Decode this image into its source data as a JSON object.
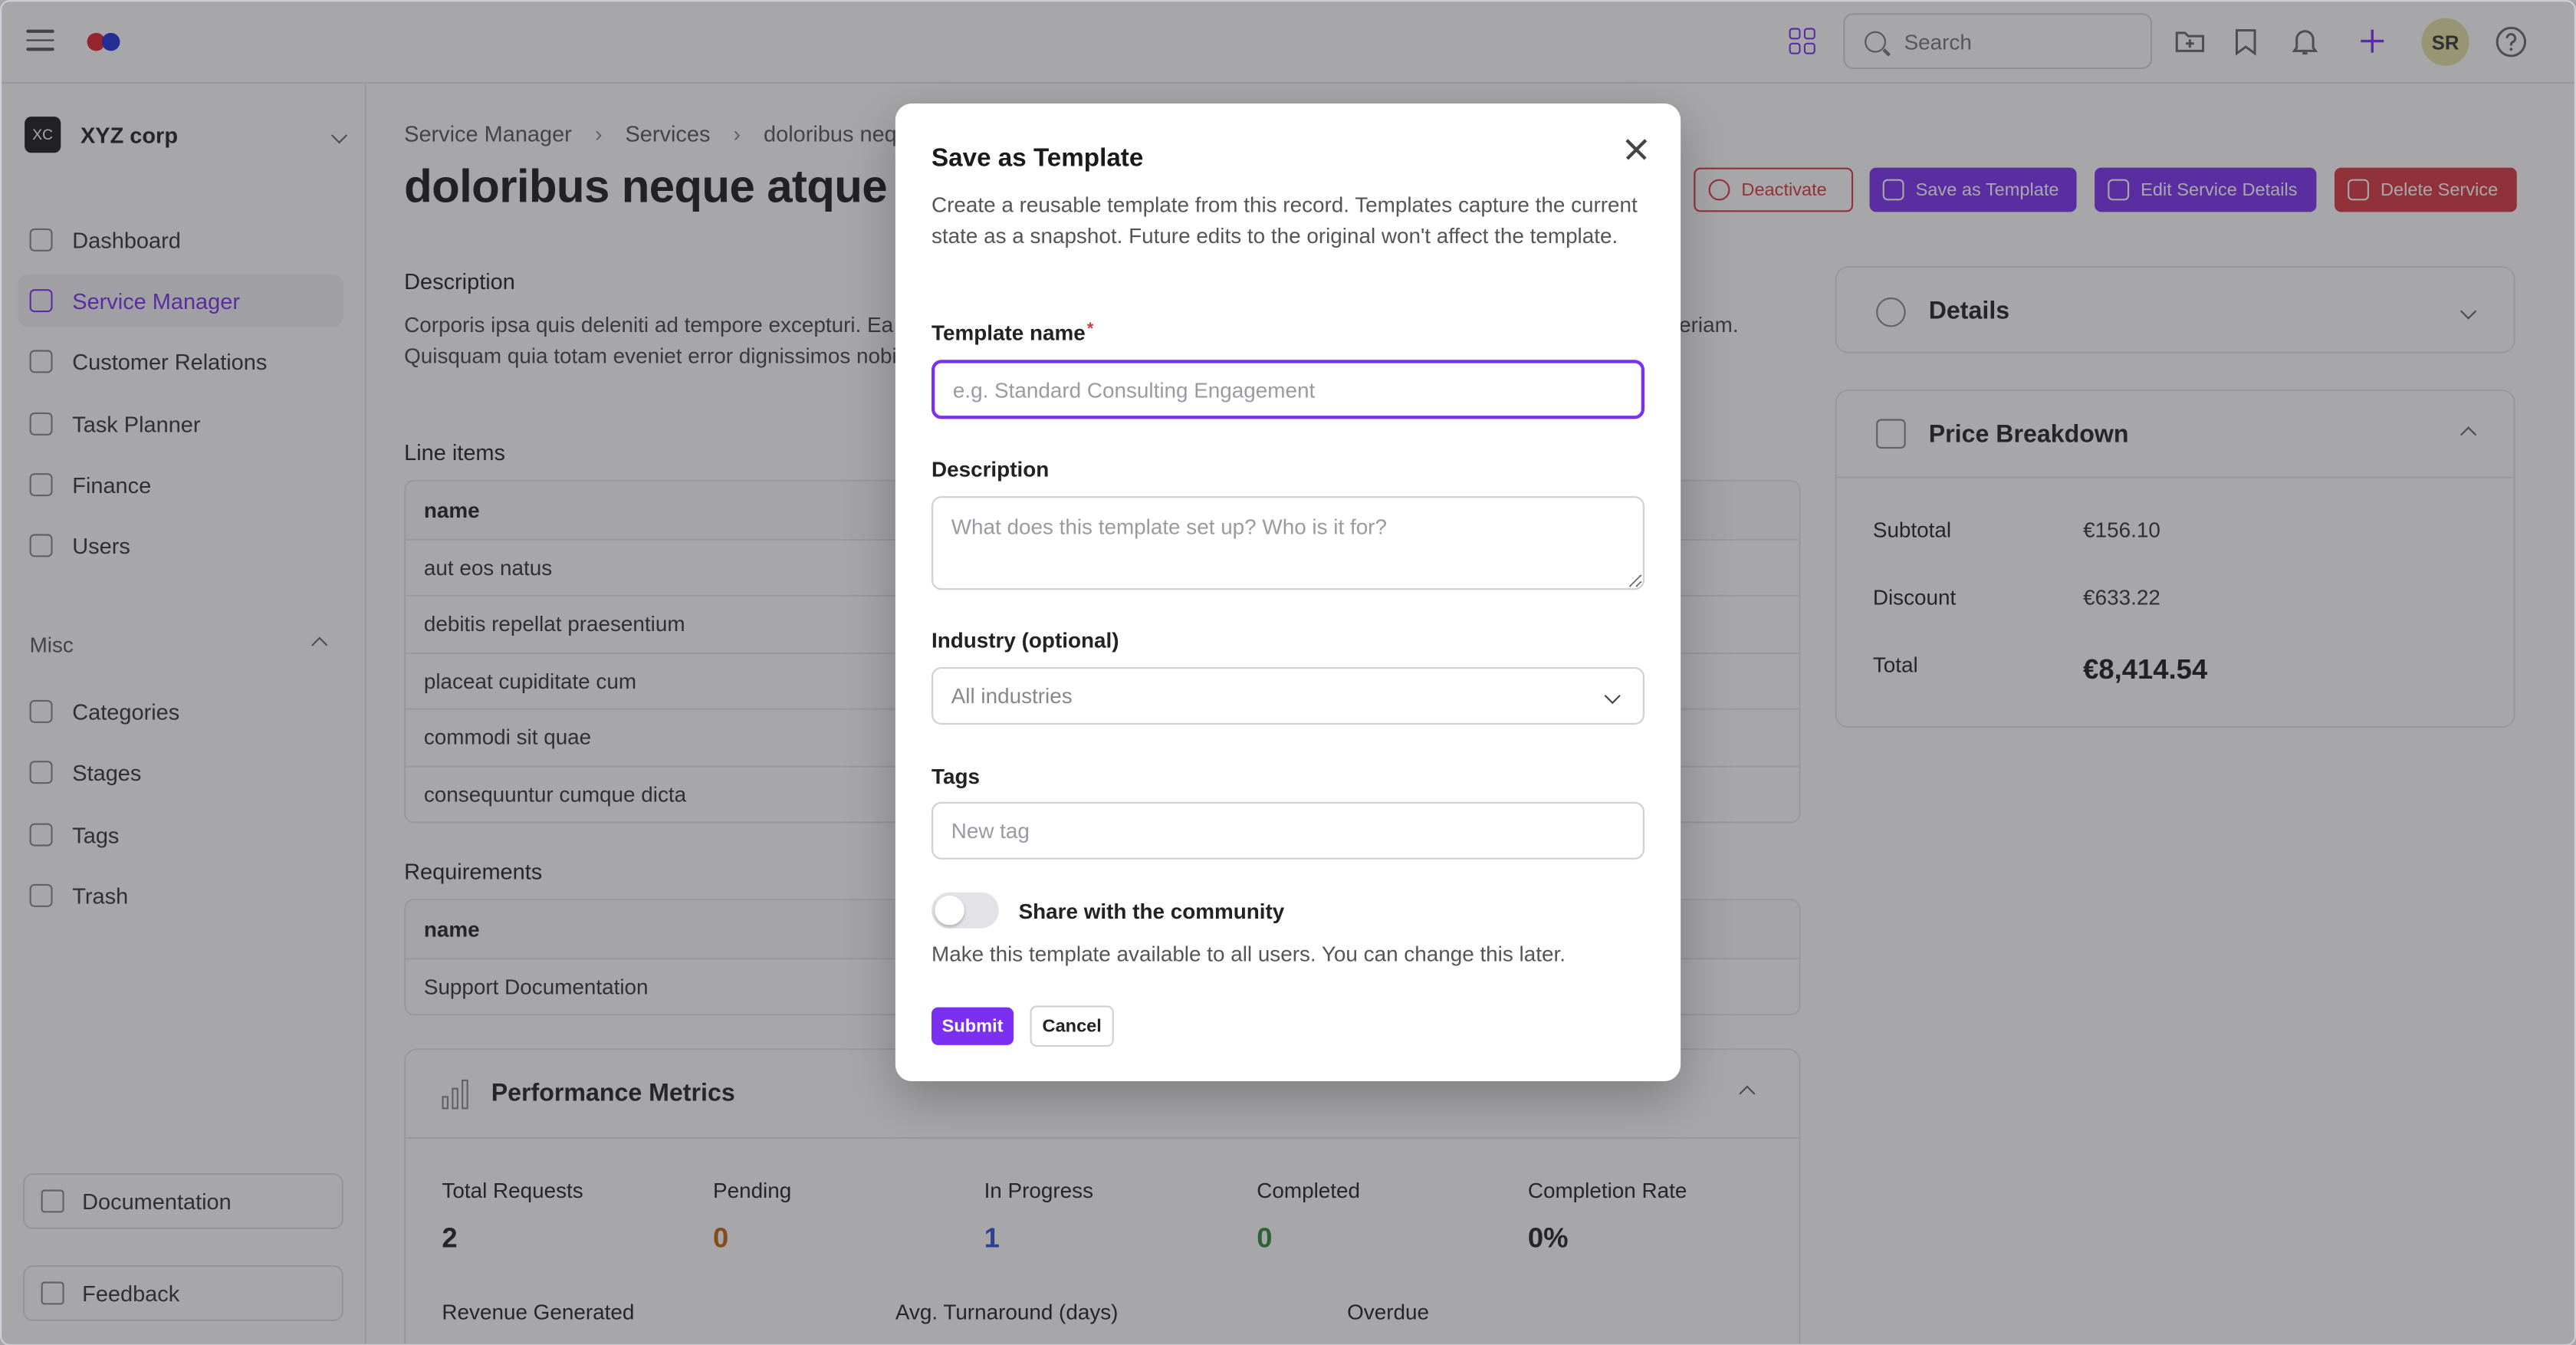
{
  "topbar": {
    "search_placeholder": "Search",
    "avatar_initials": "SR",
    "icons": [
      "menu-icon",
      "apps-grid-icon",
      "search-icon",
      "folder-add-icon",
      "bookmark-icon",
      "bell-icon",
      "plus-icon",
      "help-icon"
    ],
    "accent": "#7b2ff0"
  },
  "sidebar": {
    "org": {
      "badge": "XC",
      "name": "XYZ corp"
    },
    "items": [
      {
        "label": "Dashboard",
        "icon": "dashboard-icon"
      },
      {
        "label": "Service Manager",
        "icon": "tools-icon",
        "active": true
      },
      {
        "label": "Customer Relations",
        "icon": "people-icon"
      },
      {
        "label": "Task Planner",
        "icon": "grid-icon"
      },
      {
        "label": "Finance",
        "icon": "money-icon"
      },
      {
        "label": "Users",
        "icon": "users-icon"
      }
    ],
    "misc_label": "Misc",
    "misc_items": [
      {
        "label": "Categories",
        "icon": "folder-icon"
      },
      {
        "label": "Stages",
        "icon": "layers-icon"
      },
      {
        "label": "Tags",
        "icon": "tag-icon"
      },
      {
        "label": "Trash",
        "icon": "trash-icon"
      }
    ],
    "documentation": "Documentation",
    "feedback": "Feedback"
  },
  "main": {
    "breadcrumbs": [
      "Service Manager",
      "Services",
      "doloribus neque atque"
    ],
    "title": "doloribus neque atque",
    "actions": {
      "deactivate": "Deactivate",
      "save_template": "Save as Template",
      "edit": "Edit Service Details",
      "delete": "Delete Service"
    },
    "description_label": "Description",
    "description": "Corporis ipsa quis deleniti ad tempore excepturi. Ea sit quis qui ratione est. Sint quae nostrum dolorem corrupti enim nemo expedita aperiam. Quisquam quia totam eveniet error dignissimos nobis. Unde tempora minus dolore aliquid quia.",
    "line_items_label": "Line items",
    "line_items": {
      "header": "name",
      "rows": [
        "aut eos natus",
        "debitis repellat praesentium",
        "placeat cupiditate cum",
        "commodi sit quae",
        "consequuntur cumque dicta"
      ]
    },
    "requirements_label": "Requirements",
    "requirements": {
      "header": "name",
      "rows": [
        "Support Documentation"
      ]
    },
    "performance": {
      "title": "Performance Metrics",
      "metrics": [
        {
          "label": "Total Requests",
          "value": "2",
          "color": "#222222"
        },
        {
          "label": "Pending",
          "value": "0",
          "color": "#c2620a"
        },
        {
          "label": "In Progress",
          "value": "1",
          "color": "#2f4fd6"
        },
        {
          "label": "Completed",
          "value": "0",
          "color": "#2f8a3b"
        },
        {
          "label": "Completion Rate",
          "value": "0%",
          "color": "#222222"
        }
      ],
      "row2": [
        "Revenue Generated",
        "Avg. Turnaround (days)",
        "Overdue"
      ]
    },
    "details": {
      "title": "Details"
    },
    "price": {
      "title": "Price Breakdown",
      "subtotal_label": "Subtotal",
      "subtotal": "€156.10",
      "discount_label": "Discount",
      "discount": "€633.22",
      "total_label": "Total",
      "total": "€8,414.54"
    }
  },
  "modal": {
    "title": "Save as Template",
    "subtitle": "Create a reusable template from this record. Templates capture the current state as a snapshot. Future edits to the original won't affect the template.",
    "name_label": "Template name",
    "required_mark": "*",
    "name_placeholder": "e.g. Standard Consulting Engagement",
    "description_label": "Description",
    "description_placeholder": "What does this template set up? Who is it for?",
    "industry_label": "Industry (optional)",
    "industry_value": "All industries",
    "tags_label": "Tags",
    "tags_placeholder": "New tag",
    "share_label": "Share with the community",
    "share_on": false,
    "share_help": "Make this template available to all users. You can change this later.",
    "submit": "Submit",
    "cancel": "Cancel"
  }
}
